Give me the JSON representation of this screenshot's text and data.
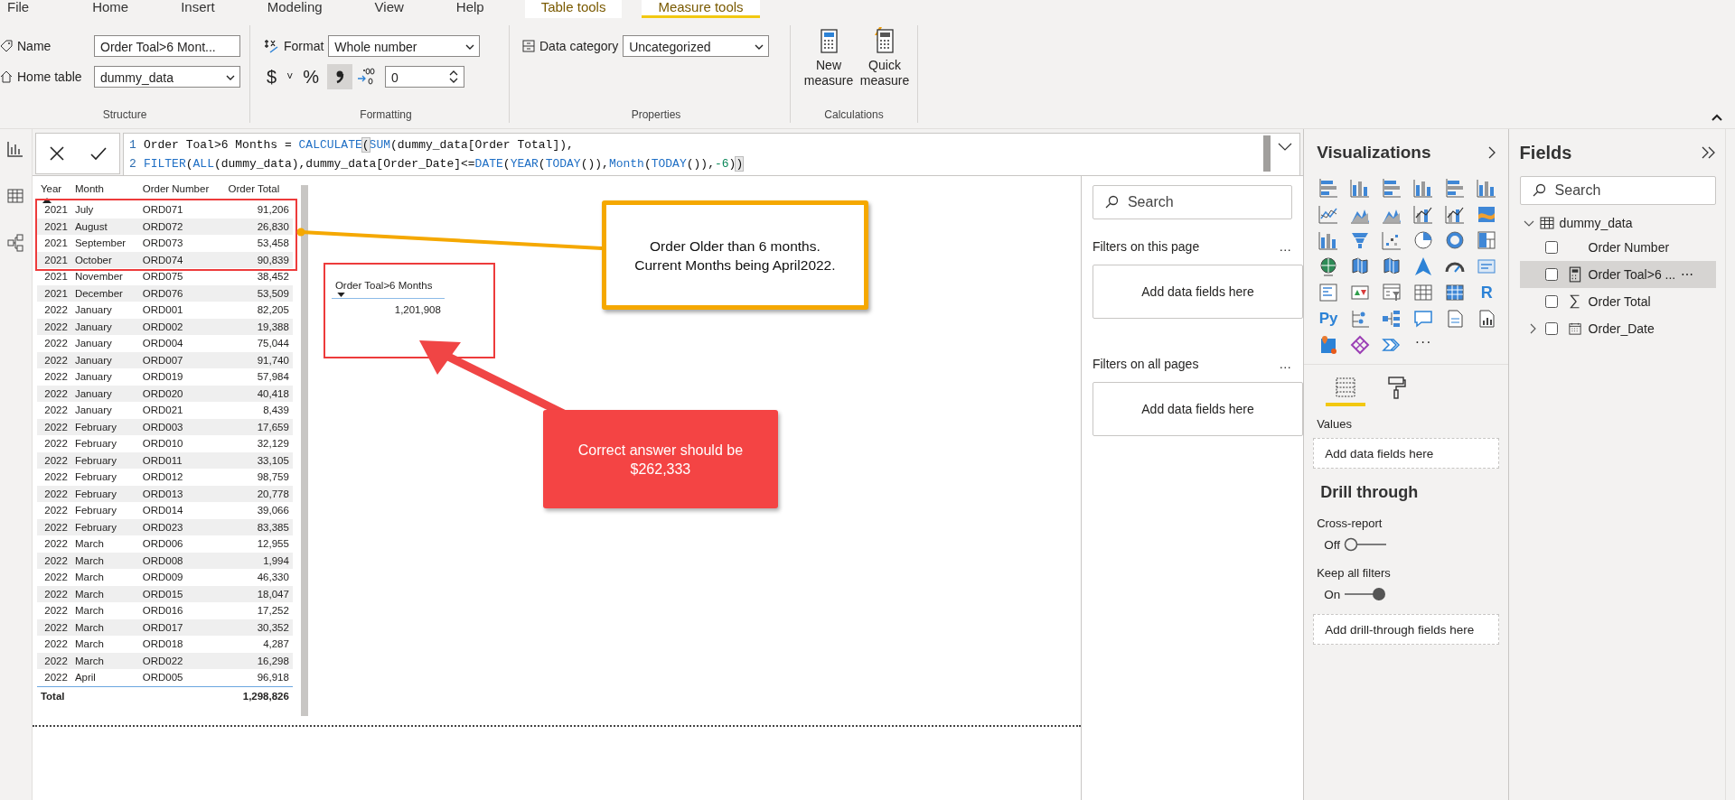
{
  "ribbon_tabs": [
    {
      "label": "File",
      "kind": "standard",
      "selected": false
    },
    {
      "label": "Home",
      "kind": "standard",
      "selected": false
    },
    {
      "label": "Insert",
      "kind": "standard",
      "selected": false
    },
    {
      "label": "Modeling",
      "kind": "standard",
      "selected": false
    },
    {
      "label": "View",
      "kind": "standard",
      "selected": false
    },
    {
      "label": "Help",
      "kind": "standard",
      "selected": false
    },
    {
      "label": "Table tools",
      "kind": "contextual",
      "selected": false
    },
    {
      "label": "Measure tools",
      "kind": "contextual",
      "selected": true
    }
  ],
  "ribbon": {
    "structure": {
      "title": "Structure",
      "name_label": "Name",
      "name_value": "Order Toal>6 Mont...",
      "home_table_label": "Home table",
      "home_table_value": "dummy_data"
    },
    "formatting": {
      "title": "Formatting",
      "format_label": "Format",
      "format_value": "Whole number",
      "currency": "$",
      "currency_caret": "˅",
      "percent": "%",
      "comma_selected": true,
      "decimals": "0"
    },
    "properties": {
      "title": "Properties",
      "category_label": "Data category",
      "category_value": "Uncategorized"
    },
    "calculations": {
      "title": "Calculations",
      "buttons": [
        {
          "label": "New measure",
          "kind": "new"
        },
        {
          "label": "Quick measure",
          "kind": "quick"
        }
      ]
    }
  },
  "formula": {
    "lines": [
      {
        "number": "1",
        "tokens": [
          {
            "text": "Order Toal>6 Months = ",
            "kind": "plain"
          },
          {
            "text": "CALCULATE",
            "kind": "function"
          },
          {
            "text": "(",
            "kind": "match"
          },
          {
            "text": "SUM",
            "kind": "function"
          },
          {
            "text": "(dummy_data[Order Total]),",
            "kind": "plain"
          }
        ]
      },
      {
        "number": "2",
        "tokens": [
          {
            "text": "FILTER",
            "kind": "function"
          },
          {
            "text": "(",
            "kind": "plain"
          },
          {
            "text": "ALL",
            "kind": "function"
          },
          {
            "text": "(dummy_data),dummy_data[Order_Date]<=",
            "kind": "plain"
          },
          {
            "text": "DATE",
            "kind": "function"
          },
          {
            "text": "(",
            "kind": "plain"
          },
          {
            "text": "YEAR",
            "kind": "function"
          },
          {
            "text": "(",
            "kind": "plain"
          },
          {
            "text": "TODAY",
            "kind": "function"
          },
          {
            "text": "()),",
            "kind": "plain"
          },
          {
            "text": "Month",
            "kind": "function"
          },
          {
            "text": "(",
            "kind": "plain"
          },
          {
            "text": "TODAY",
            "kind": "function"
          },
          {
            "text": "()),",
            "kind": "plain"
          },
          {
            "text": "-6",
            "kind": "number"
          },
          {
            "text": ")",
            "kind": "plain"
          },
          {
            "text": ")",
            "kind": "match"
          }
        ]
      }
    ]
  },
  "table": {
    "columns": [
      {
        "label": "Year",
        "sorted": true
      },
      {
        "label": "Month",
        "sorted": false
      },
      {
        "label": "Order Number",
        "sorted": false
      },
      {
        "label": "Order Total",
        "sorted": false
      }
    ],
    "rows": [
      [
        "2021",
        "July",
        "ORD071",
        "91,206"
      ],
      [
        "2021",
        "August",
        "ORD072",
        "26,830"
      ],
      [
        "2021",
        "September",
        "ORD073",
        "53,458"
      ],
      [
        "2021",
        "October",
        "ORD074",
        "90,839"
      ],
      [
        "2021",
        "November",
        "ORD075",
        "38,452"
      ],
      [
        "2021",
        "December",
        "ORD076",
        "53,509"
      ],
      [
        "2022",
        "January",
        "ORD001",
        "82,205"
      ],
      [
        "2022",
        "January",
        "ORD002",
        "19,388"
      ],
      [
        "2022",
        "January",
        "ORD004",
        "75,044"
      ],
      [
        "2022",
        "January",
        "ORD007",
        "91,740"
      ],
      [
        "2022",
        "January",
        "ORD019",
        "57,984"
      ],
      [
        "2022",
        "January",
        "ORD020",
        "40,418"
      ],
      [
        "2022",
        "January",
        "ORD021",
        "8,439"
      ],
      [
        "2022",
        "February",
        "ORD003",
        "17,659"
      ],
      [
        "2022",
        "February",
        "ORD010",
        "32,129"
      ],
      [
        "2022",
        "February",
        "ORD011",
        "33,105"
      ],
      [
        "2022",
        "February",
        "ORD012",
        "98,759"
      ],
      [
        "2022",
        "February",
        "ORD013",
        "20,778"
      ],
      [
        "2022",
        "February",
        "ORD014",
        "39,066"
      ],
      [
        "2022",
        "February",
        "ORD023",
        "83,385"
      ],
      [
        "2022",
        "March",
        "ORD006",
        "12,955"
      ],
      [
        "2022",
        "March",
        "ORD008",
        "1,994"
      ],
      [
        "2022",
        "March",
        "ORD009",
        "46,330"
      ],
      [
        "2022",
        "March",
        "ORD015",
        "18,047"
      ],
      [
        "2022",
        "March",
        "ORD016",
        "17,252"
      ],
      [
        "2022",
        "March",
        "ORD017",
        "30,352"
      ],
      [
        "2022",
        "March",
        "ORD018",
        "4,287"
      ],
      [
        "2022",
        "March",
        "ORD022",
        "16,298"
      ],
      [
        "2022",
        "April",
        "ORD005",
        "96,918"
      ]
    ],
    "total": {
      "label": "Total",
      "value": "1,298,826"
    }
  },
  "card": {
    "title": "Order Toal>6 Months",
    "sorted": true,
    "value": "1,201,908"
  },
  "annotations": {
    "callout": "Order Older than 6 months.\nCurrent Months being April2022.",
    "answer": "Correct answer should be\n$262,333"
  },
  "filters": {
    "search_placeholder": "Search",
    "sections": [
      {
        "title": "Filters on this page",
        "more": "…",
        "drop": "Add data fields here"
      },
      {
        "title": "Filters on all pages",
        "more": "…",
        "drop": "Add data fields here"
      }
    ]
  },
  "visualizations": {
    "title": "Visualizations",
    "script_visuals": [
      "R",
      "Py"
    ],
    "more": "···",
    "build_tabs": [
      {
        "kind": "fields",
        "selected": true
      },
      {
        "kind": "format",
        "selected": false
      }
    ],
    "values_label": "Values",
    "values_drop": "Add data fields here",
    "drill_title": "Drill through",
    "toggles": [
      {
        "label": "Cross-report",
        "state": "Off",
        "on": false
      },
      {
        "label": "Keep all filters",
        "state": "On",
        "on": true
      }
    ],
    "drill_drop": "Add drill-through fields here"
  },
  "fields": {
    "title": "Fields",
    "search_placeholder": "Search",
    "tables": [
      {
        "name": "dummy_data",
        "expanded": true,
        "children": [
          {
            "name": "Order Number",
            "kind": "column",
            "checked": false,
            "selected": false
          },
          {
            "name": "Order Toal>6 ...",
            "kind": "measure",
            "checked": false,
            "selected": true,
            "more": "⋯"
          },
          {
            "name": "Order Total",
            "kind": "sum",
            "checked": false,
            "selected": false
          },
          {
            "name": "Order_Date",
            "kind": "date",
            "checked": false,
            "selected": false,
            "expanded": false
          }
        ]
      }
    ]
  }
}
